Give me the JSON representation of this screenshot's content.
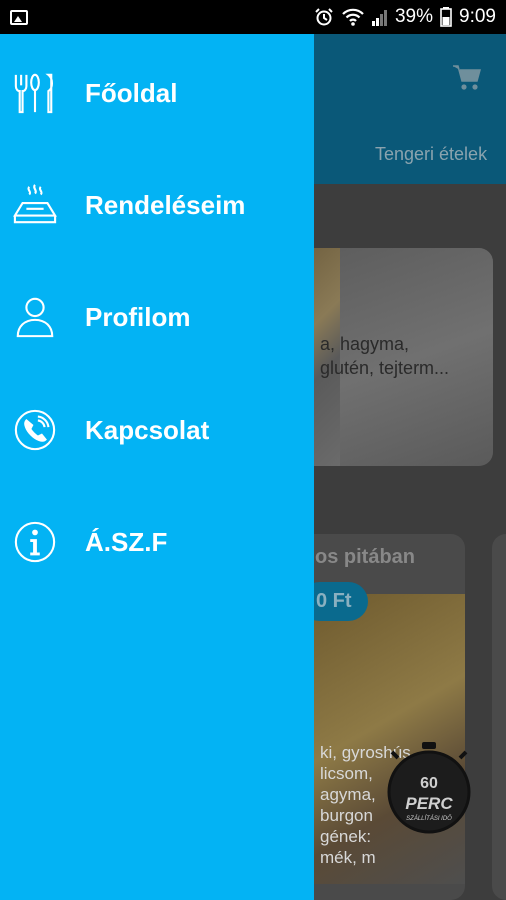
{
  "status_bar": {
    "battery": "39%",
    "time": "9:09"
  },
  "drawer": {
    "items": [
      {
        "label": "Főoldal",
        "icon": "utensils-icon"
      },
      {
        "label": "Rendeléseim",
        "icon": "hot-dish-icon"
      },
      {
        "label": "Profilom",
        "icon": "user-icon"
      },
      {
        "label": "Kapcsolat",
        "icon": "phone-icon"
      },
      {
        "label": "Á.SZ.F",
        "icon": "info-icon"
      }
    ]
  },
  "background": {
    "tab_partial": "k",
    "tab_seafood": "Tengeri ételek",
    "card1_line1": "a, hagyma,",
    "card1_line2": "glutén, tejterm...",
    "card2_title": "os pitában",
    "card2_price": "0 Ft",
    "card2_desc": "ki, gyroshús,\nlicsom,\nagyma,\nburgon\ngének: \nmék, m",
    "badge": {
      "number": "60",
      "word": "PERC",
      "sub": "SZÁLLÍTÁSI IDŐ"
    }
  },
  "colors": {
    "drawer": "#03b3f4",
    "header_dim": "#0a5878"
  }
}
